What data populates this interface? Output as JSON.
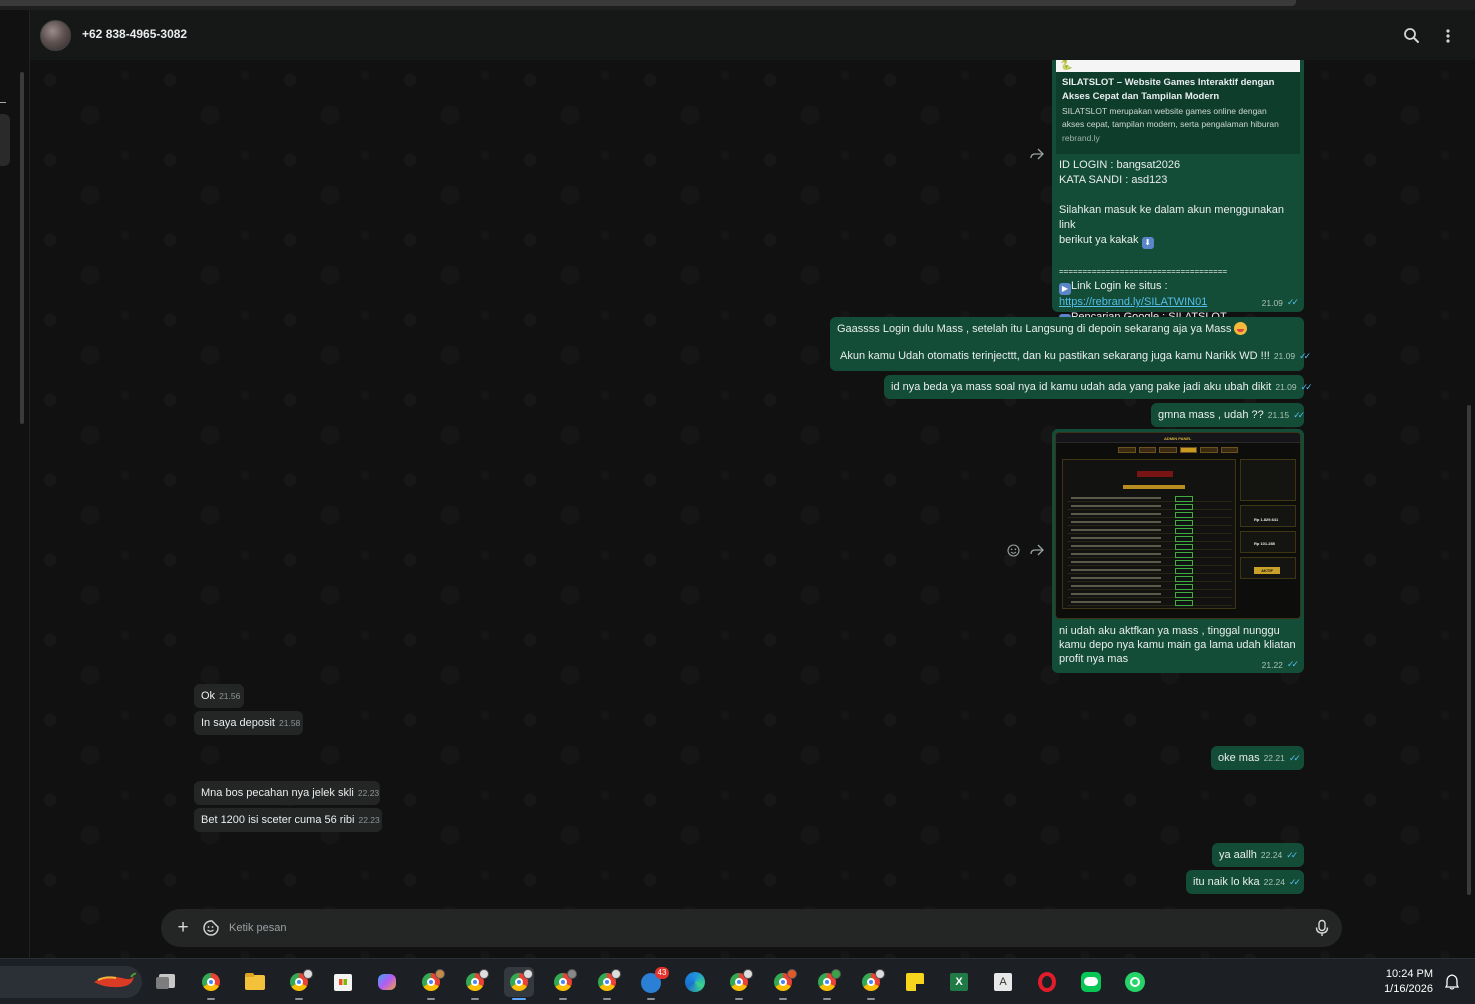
{
  "chat": {
    "contact_name": "+62 838-4965-3082",
    "composer_placeholder": "Ketik pesan"
  },
  "preview_message": {
    "image_text": "🐍",
    "card_title_1": "SILATSLOT – Website Games Interaktif dengan",
    "card_title_2": "Akses Cepat dan Tampilan Modern",
    "card_desc_1": "SILATSLOT merupakan website games online dengan",
    "card_desc_2": "akses cepat, tampilan modern, serta pengalaman hiburan",
    "card_domain": "rebrand.ly",
    "login_id": "ID LOGIN : bangsat2026",
    "password": "KATA SANDI : asd123",
    "instruction_1": "Silahkan masuk ke dalam akun menggunakan link",
    "instruction_2": "berikut ya kakak",
    "separator": "====================================",
    "link_label": "Link Login ke situs  :",
    "link_url": "https://rebrand.ly/SILATWIN01",
    "google_label": "Pencarian Google : SILATSLOT",
    "time": "21.09"
  },
  "messages": {
    "m1_line1": "Gaassss Login dulu Mass  , setelah itu Langsung di depoin sekarang aja ya Mass",
    "m1_line2": "Akun kamu Udah otomatis terinjecttt, dan ku pastikan sekarang juga kamu Narikk WD !!!",
    "m1_time": "21.09",
    "m2_text": "id nya beda ya mass soal nya id kamu udah ada yang pake jadi aku ubah dikit",
    "m2_time": "21.09",
    "m3_text": "gmna mass , udah ??",
    "m3_time": "21.15",
    "img_caption": "ni udah aku aktfkan ya mass , tinggal nunggu kamu depo nya kamu main ga lama udah kliatan profit nya mas",
    "img_time": "21.22",
    "in1_text": "Ok",
    "in1_time": "21.56",
    "in2_text": "In saya deposit",
    "in2_time": "21.58",
    "m4_text": "oke mas",
    "m4_time": "22.21",
    "in3_text": "Mna bos pecahan nya jelek skli",
    "in3_time": "22.23",
    "in4_text": "Bet 1200 isi sceter cuma 56 ribi",
    "in4_time": "22.23",
    "m5_text": "ya aallh",
    "m5_time": "22.24",
    "m6_text": "itu naik lo kka",
    "m6_time": "22.24"
  },
  "screenshot_panel": {
    "title": "ADMIN PANEL",
    "header": "ROOM AKTIVASI JACKPOT",
    "saldo": "Rp 1.829.641",
    "deposit": "Rp 101.285",
    "status": "AKTIF"
  },
  "taskbar": {
    "time": "10:24 PM",
    "date": "1/16/2026",
    "badge_count": "43"
  },
  "colors": {
    "outgoing_bubble": "#144d37",
    "incoming_bubble": "#242626",
    "chat_background": "#111111",
    "read_ticks": "#53bdeb"
  },
  "icons": [
    "search-icon",
    "menu-dots-icon",
    "forward-icon",
    "emoji-reaction-icon",
    "plus-icon",
    "sticker-icon",
    "mic-icon"
  ]
}
